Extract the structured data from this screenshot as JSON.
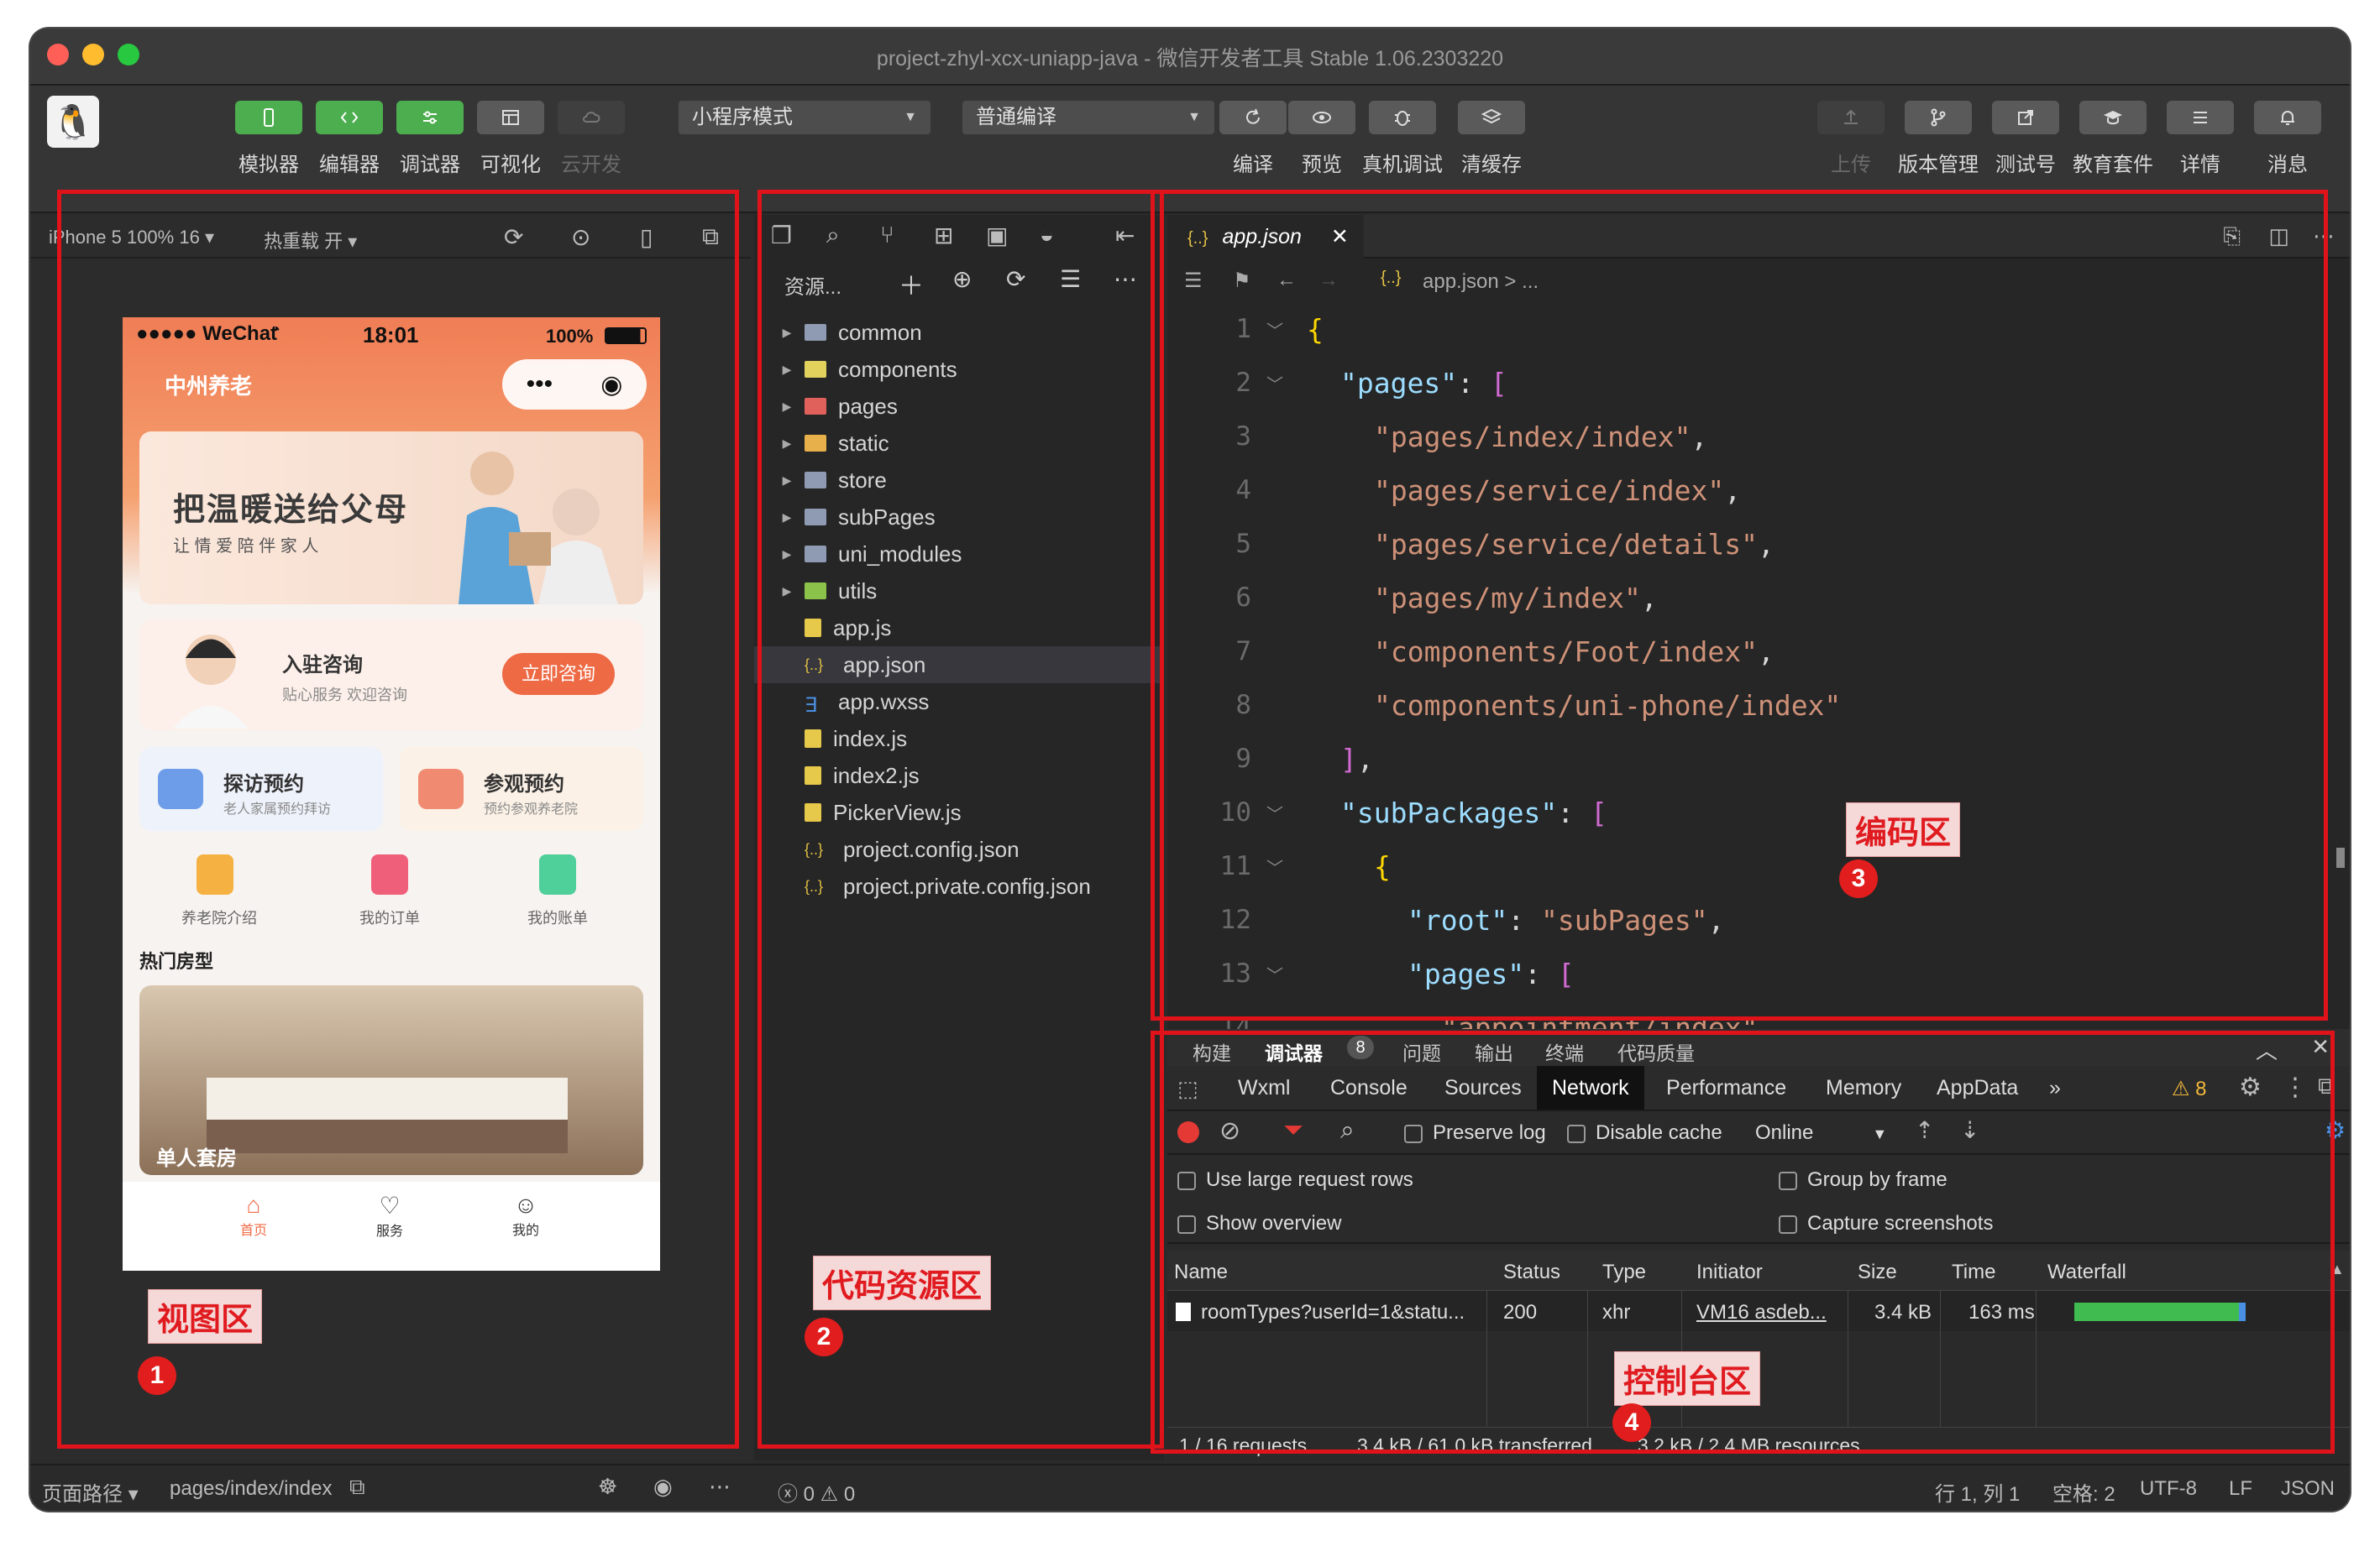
{
  "window": {
    "title": "project-zhyl-xcx-uniapp-java - 微信开发者工具 Stable 1.06.2303220"
  },
  "toolbar": {
    "left_buttons": [
      "模拟器",
      "编辑器",
      "调试器",
      "可视化",
      "云开发"
    ],
    "mode_select": "小程序模式",
    "compile_select": "普通编译",
    "mid_buttons": [
      "编译",
      "预览",
      "真机调试",
      "清缓存"
    ],
    "right_buttons": [
      "上传",
      "版本管理",
      "测试号",
      "教育套件",
      "详情",
      "消息"
    ]
  },
  "simulator": {
    "device_select": "iPhone 5 100% 16",
    "hot_reload": "热重载 开",
    "phone": {
      "carrier": "●●●●● WeChat",
      "time": "18:01",
      "battery": "100%",
      "app_title": "中州养老",
      "banner_title": "把温暖送给父母",
      "banner_sub": "让 情 爱 陪 伴 家 人",
      "consult_title": "入驻咨询",
      "consult_sub": "贴心服务 欢迎咨询",
      "consult_button": "立即咨询",
      "visit_title": "探访预约",
      "visit_sub": "老人家属预约拜访",
      "tour_title": "参观预约",
      "tour_sub": "预约参观养老院",
      "icons": [
        "养老院介绍",
        "我的订单",
        "我的账单"
      ],
      "section_title": "热门房型",
      "room_label": "单人套房",
      "tabs": [
        "首页",
        "服务",
        "我的"
      ]
    },
    "footer_path_label": "页面路径",
    "footer_path": "pages/index/index"
  },
  "explorer": {
    "header": "资源...",
    "items": [
      {
        "name": "common",
        "type": "folder"
      },
      {
        "name": "components",
        "type": "folder"
      },
      {
        "name": "pages",
        "type": "folder"
      },
      {
        "name": "static",
        "type": "folder"
      },
      {
        "name": "store",
        "type": "folder"
      },
      {
        "name": "subPages",
        "type": "folder"
      },
      {
        "name": "uni_modules",
        "type": "folder"
      },
      {
        "name": "utils",
        "type": "folder"
      },
      {
        "name": "app.js",
        "type": "js"
      },
      {
        "name": "app.json",
        "type": "json"
      },
      {
        "name": "app.wxss",
        "type": "wxss"
      },
      {
        "name": "index.js",
        "type": "js"
      },
      {
        "name": "index2.js",
        "type": "js"
      },
      {
        "name": "PickerView.js",
        "type": "js"
      },
      {
        "name": "project.config.json",
        "type": "json"
      },
      {
        "name": "project.private.config.json",
        "type": "json"
      }
    ],
    "footer_status": "ⓧ 0 ⚠ 0"
  },
  "editor": {
    "tab": "app.json",
    "breadcrumb": "app.json > ...",
    "lines": [
      "{",
      "\"pages\": [",
      "\"pages/index/index\",",
      "\"pages/service/index\",",
      "\"pages/service/details\",",
      "\"pages/my/index\",",
      "\"components/Foot/index\",",
      "\"components/uni-phone/index\"",
      "],",
      "\"subPackages\": [",
      "{",
      "\"root\": \"subPages\",",
      "\"pages\": [",
      "\"appointment/index\","
    ]
  },
  "debugger": {
    "top_tabs": [
      "构建",
      "调试器",
      "问题",
      "输出",
      "终端",
      "代码质量"
    ],
    "debugger_badge": "8",
    "tool_tabs": [
      "Wxml",
      "Console",
      "Sources",
      "Network",
      "Performance",
      "Memory",
      "AppData"
    ],
    "warnings": "⚠ 8",
    "preserve_log": "Preserve log",
    "disable_cache": "Disable cache",
    "throttle": "Online",
    "options": [
      "Use large request rows",
      "Show overview",
      "Group by frame",
      "Capture screenshots"
    ],
    "columns": [
      "Name",
      "Status",
      "Type",
      "Initiator",
      "Size",
      "Time",
      "Waterfall"
    ],
    "rows": [
      {
        "name": "roomTypes?userId=1&statu...",
        "status": "200",
        "type": "xhr",
        "initiator": "VM16 asdeb...",
        "size": "3.4 kB",
        "time": "163 ms"
      }
    ],
    "summary": [
      "1 / 16 requests",
      "3.4 kB / 61.0 kB transferred",
      "3.2 kB / 2.4 MB resources"
    ]
  },
  "statusbar": {
    "items": [
      "行 1, 列 1",
      "空格: 2",
      "UTF-8",
      "LF",
      "JSON"
    ]
  },
  "annotations": [
    {
      "label": "视图区",
      "num": "1"
    },
    {
      "label": "代码资源区",
      "num": "2"
    },
    {
      "label": "编码区",
      "num": "3"
    },
    {
      "label": "控制台区",
      "num": "4"
    }
  ],
  "colors": {
    "accent_green": "#4cae4f",
    "annotation_red": "#e0121a",
    "phone_orange": "#f07d55"
  }
}
